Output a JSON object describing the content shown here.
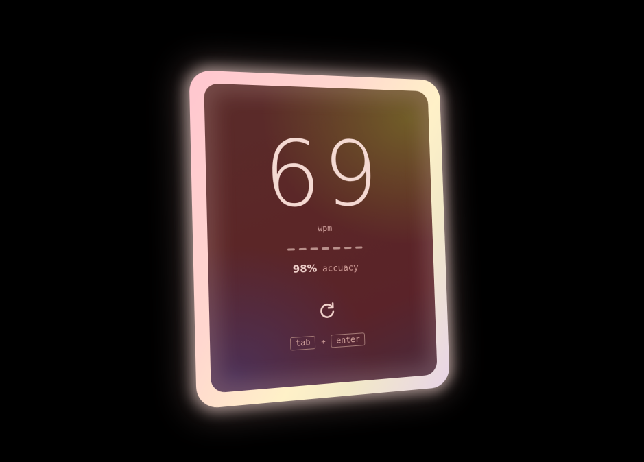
{
  "result": {
    "wpm": "69",
    "wpm_unit": "wpm",
    "accuracy_value": "98%",
    "accuracy_label": "accuacy"
  },
  "restart": {
    "icon": "refresh-icon"
  },
  "shortcut": {
    "key1": "tab",
    "plus": "+",
    "key2": "enter"
  },
  "colors": {
    "frame": "#ffd7cf",
    "screen": "#5a2627",
    "text": "#f4d9d2",
    "muted": "#c99a96"
  }
}
